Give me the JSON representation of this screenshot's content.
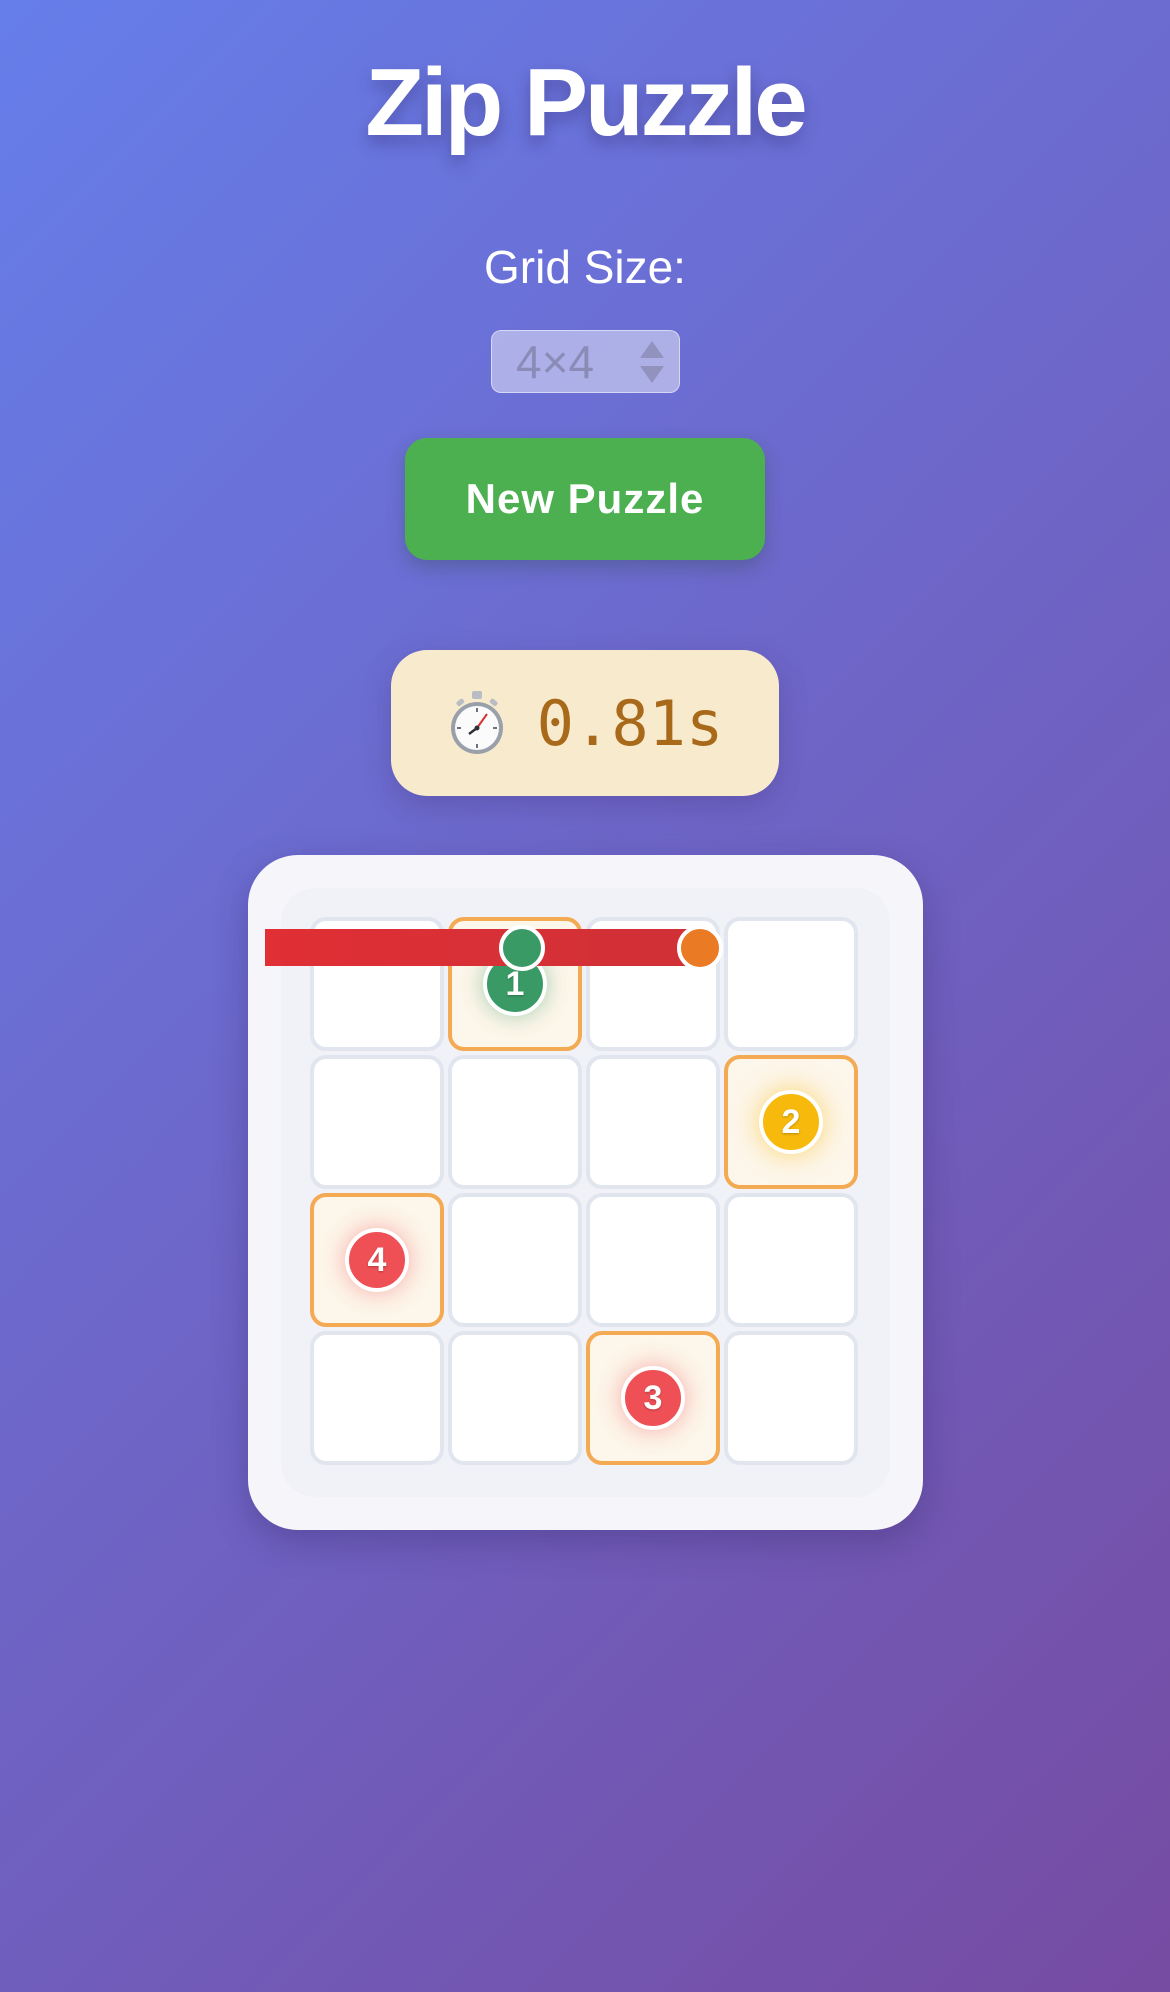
{
  "header": {
    "title": "Zip Puzzle"
  },
  "controls": {
    "grid_size_label": "Grid Size:",
    "grid_size_value": "4×4",
    "new_puzzle_label": "New Puzzle"
  },
  "timer": {
    "icon": "stopwatch-icon",
    "value": "0.81s"
  },
  "board": {
    "rows": 4,
    "cols": 4,
    "numbers": [
      {
        "label": "1",
        "row": 1,
        "col": 2,
        "color": "#3a9a66"
      },
      {
        "label": "2",
        "row": 2,
        "col": 4,
        "color": "#f7b90b"
      },
      {
        "label": "3",
        "row": 4,
        "col": 3,
        "color": "#ee5056"
      },
      {
        "label": "4",
        "row": 3,
        "col": 1,
        "color": "#ee5056"
      }
    ],
    "path": {
      "color": "#d62f35",
      "start_color": "#3a9a66",
      "end_color": "#ea7a23"
    }
  },
  "colors": {
    "background_start": "#667eea",
    "background_end": "#764ba2",
    "button": "#4caf50",
    "timer_bg": "#f8ebcd",
    "timer_text": "#a9691a",
    "highlight_border": "#f3aa52"
  }
}
